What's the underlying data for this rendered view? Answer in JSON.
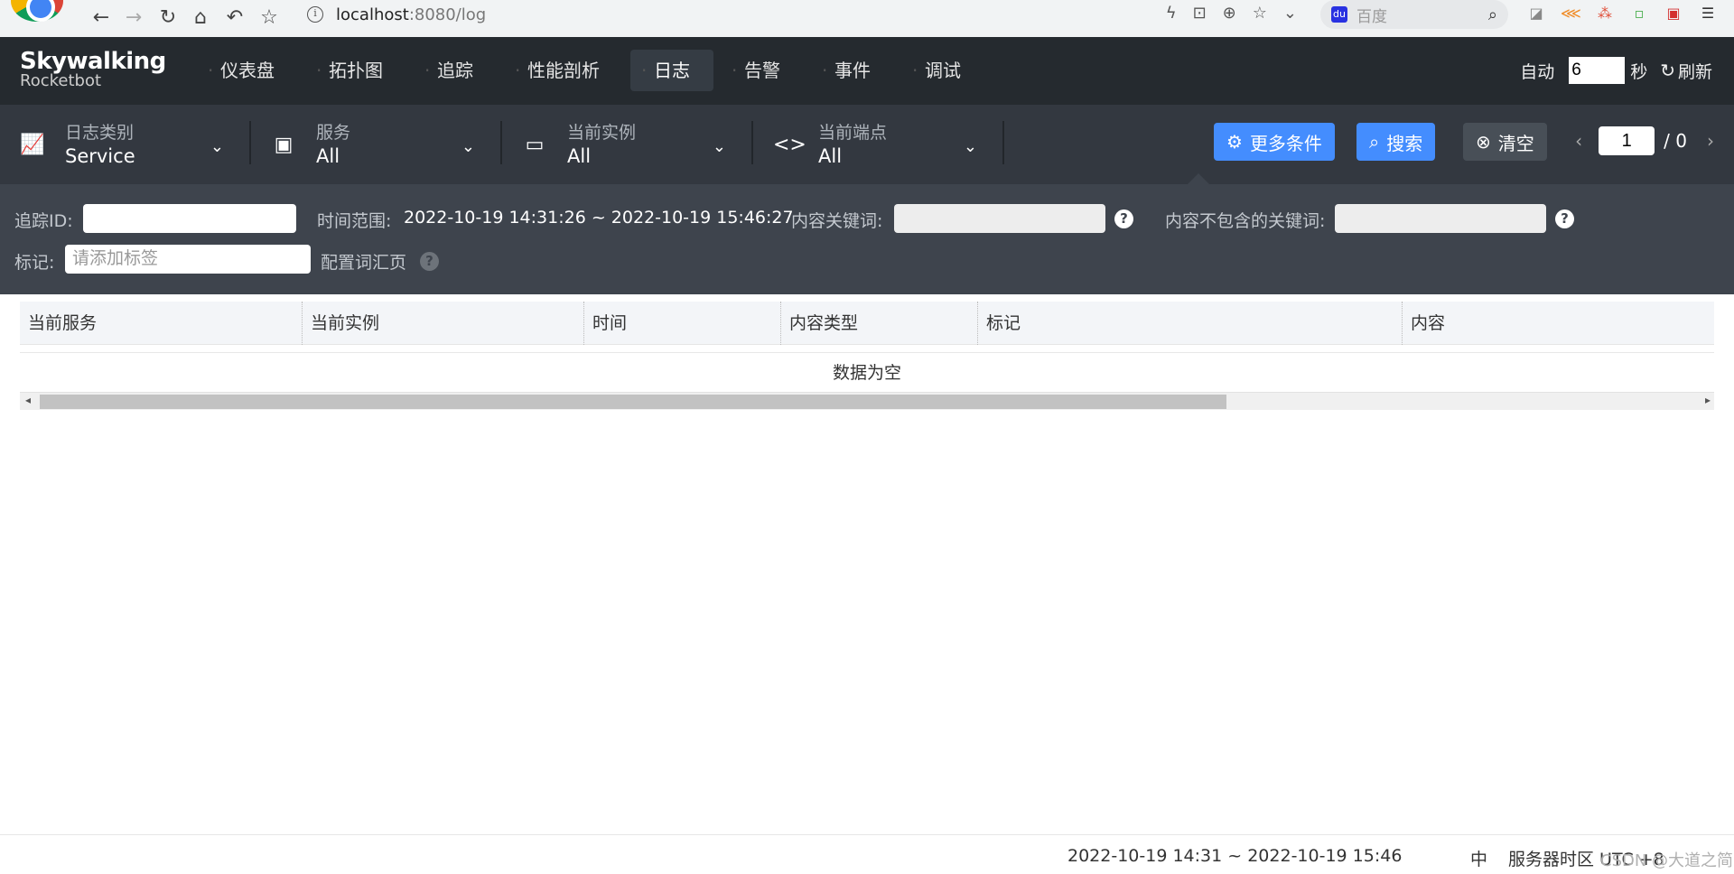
{
  "browser": {
    "url_host": "localhost",
    "url_path": ":8080/log",
    "search_placeholder": "百度",
    "search_logo": "du"
  },
  "header": {
    "brand": "Skywalking",
    "product": "Rocketbot",
    "nav": [
      "仪表盘",
      "拓扑图",
      "追踪",
      "性能剖析",
      "日志",
      "告警",
      "事件",
      "调试"
    ],
    "active_nav": "日志",
    "auto_label": "自动",
    "auto_value": "6",
    "seconds_label": "秒",
    "refresh_label": "刷新"
  },
  "filters": {
    "log_category": {
      "label": "日志类别",
      "value": "Service"
    },
    "service": {
      "label": "服务",
      "value": "All"
    },
    "instance": {
      "label": "当前实例",
      "value": "All"
    },
    "endpoint": {
      "label": "当前端点",
      "value": "All"
    },
    "more_label": "更多条件",
    "search_label": "搜索",
    "clear_label": "清空",
    "page_current": "1",
    "page_total": "/ 0"
  },
  "conditions": {
    "trace_id_label": "追踪ID:",
    "trace_id_value": "",
    "time_range_label": "时间范围:",
    "time_range_value": "2022-10-19 14:31:26 ~ 2022-10-19 15:46:27",
    "keywords_label": "内容关键词:",
    "exclude_keywords_label": "内容不包含的关键词:",
    "tags_label": "标记:",
    "tags_placeholder": "请添加标签",
    "config_label": "配置词汇页"
  },
  "table": {
    "columns": [
      "当前服务",
      "当前实例",
      "时间",
      "内容类型",
      "标记",
      "内容"
    ],
    "empty_text": "数据为空"
  },
  "footer": {
    "time_range": "2022-10-19 14:31 ~ 2022-10-19 15:46",
    "language": "中",
    "timezone": "服务器时区 UTC +8",
    "watermark": "CSDN @大道之简"
  },
  "colors": {
    "header_bg": "#252a2f",
    "filter_bg": "#333840",
    "conditions_bg": "#3e444d",
    "primary_blue": "#448dfe"
  }
}
